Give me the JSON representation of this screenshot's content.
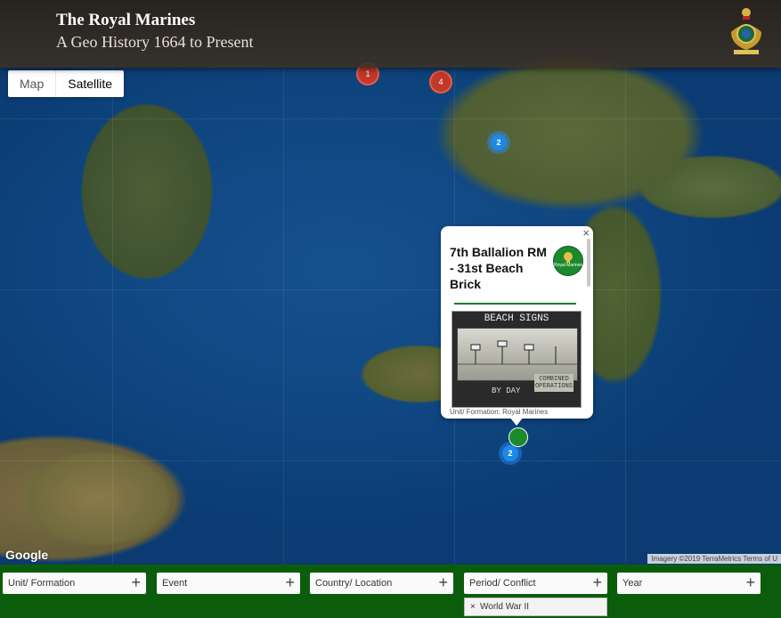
{
  "header": {
    "title": "The Royal Marines",
    "subtitle": "A Geo History 1664 to Present"
  },
  "map": {
    "type_control": {
      "map_label": "Map",
      "satellite_label": "Satellite",
      "selected": "Satellite"
    },
    "markers": {
      "red_1": "1",
      "red_2": "4",
      "blue_1": "2",
      "blue_2": "2"
    },
    "info_window": {
      "close_label": "×",
      "title": "7th Ballalion RM - 31st Beach Brick",
      "badge_text": "Royal Marines",
      "image_heading": "BEACH SIGNS",
      "image_footer": "BY DAY",
      "image_box": "COMBINED OPERATIONS",
      "cut_text": "Unit/ Formation: Royal Marines"
    },
    "google_logo": "Google",
    "attribution": "Imagery ©2019 TerraMetrics   Terms of U"
  },
  "filters": [
    {
      "label": "Unit/ Formation",
      "plus": "+"
    },
    {
      "label": "Event",
      "plus": "+"
    },
    {
      "label": "Country/ Location",
      "plus": "+"
    },
    {
      "label": "Period/ Conflict",
      "plus": "+"
    },
    {
      "label": "Year",
      "plus": "+"
    }
  ],
  "active_filter_chip": {
    "remove": "×",
    "label": "World War II"
  },
  "colors": {
    "filter_bar": "#0b5d0b",
    "header": "#2f271d",
    "accent_green": "#1d7a2c"
  }
}
